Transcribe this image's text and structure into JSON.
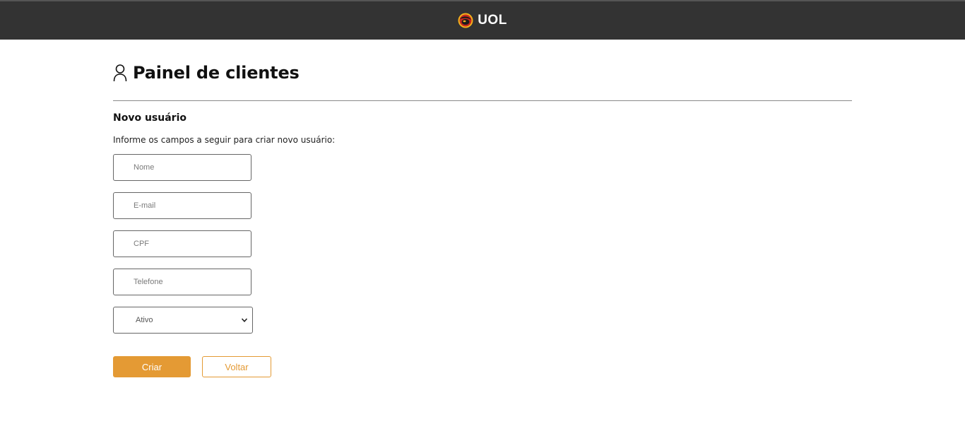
{
  "header": {
    "brand": "UOL",
    "logo_icon": "uol-logo-icon"
  },
  "page": {
    "title": "Painel de clientes",
    "title_icon": "user-icon"
  },
  "form": {
    "section_title": "Novo usuário",
    "instructions": "Informe os campos a seguir para criar novo usuário:",
    "fields": {
      "nome": {
        "placeholder": "Nome",
        "value": ""
      },
      "email": {
        "placeholder": "E-mail",
        "value": ""
      },
      "cpf": {
        "placeholder": "CPF",
        "value": ""
      },
      "telefone": {
        "placeholder": "Telefone",
        "value": ""
      }
    },
    "status": {
      "selected": "Ativo"
    },
    "buttons": {
      "create": "Criar",
      "back": "Voltar"
    }
  },
  "colors": {
    "accent": "#e49a34",
    "topbar": "#333333"
  }
}
